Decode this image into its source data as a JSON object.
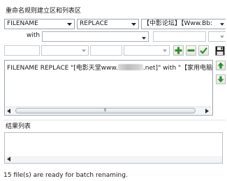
{
  "header": {
    "section_title": "重命名规则建立区和列表区",
    "mode_select": "FILENAME",
    "action_select": "REPLACE",
    "pattern_text": "【中影论坛】【Www.Bb:"
  },
  "with_row": {
    "label": "with"
  },
  "editor": {
    "text_before": "FILENAME REPLACE \"[电影天堂www.",
    "text_after": ".net]\" with \"【家用电脑"
  },
  "scrollbar": {
    "grip_glyph": "Ⅲ"
  },
  "results": {
    "title": "结果列表"
  },
  "status": {
    "message": "15 file(s) are ready for batch renaming."
  },
  "icons": {
    "add": "plus-icon",
    "remove": "minus-icon",
    "apply": "check-icon",
    "save": "floppy-disk-icon",
    "move_up": "arrow-up-icon",
    "move_down": "arrow-down-icon"
  },
  "colors": {
    "icon_green": "#2f8f2f",
    "border": "#9aa3ad"
  }
}
